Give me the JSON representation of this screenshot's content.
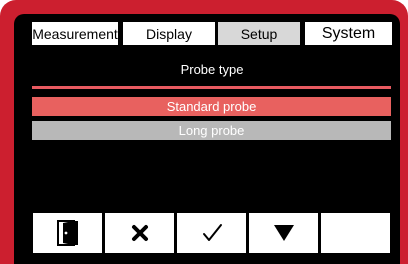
{
  "tabs": [
    {
      "label": "Measurement",
      "active": false
    },
    {
      "label": "Display",
      "active": false
    },
    {
      "label": "Setup",
      "active": true
    },
    {
      "label": "System",
      "active": false
    }
  ],
  "screen_title": "Probe type",
  "options": [
    {
      "label": "Standard probe",
      "selected": true
    },
    {
      "label": "Long probe",
      "selected": false
    }
  ],
  "function_keys": [
    {
      "icon": "exit-door-icon"
    },
    {
      "icon": "cancel-x-icon"
    },
    {
      "icon": "checkmark-icon"
    },
    {
      "icon": "arrow-down-icon"
    },
    {
      "icon": ""
    }
  ],
  "colors": {
    "frame": "#cc1f2f",
    "screen": "#000000",
    "accent": "#e85a60",
    "selected_option": "#e8615f",
    "unselected_option": "#b8b8b8"
  }
}
